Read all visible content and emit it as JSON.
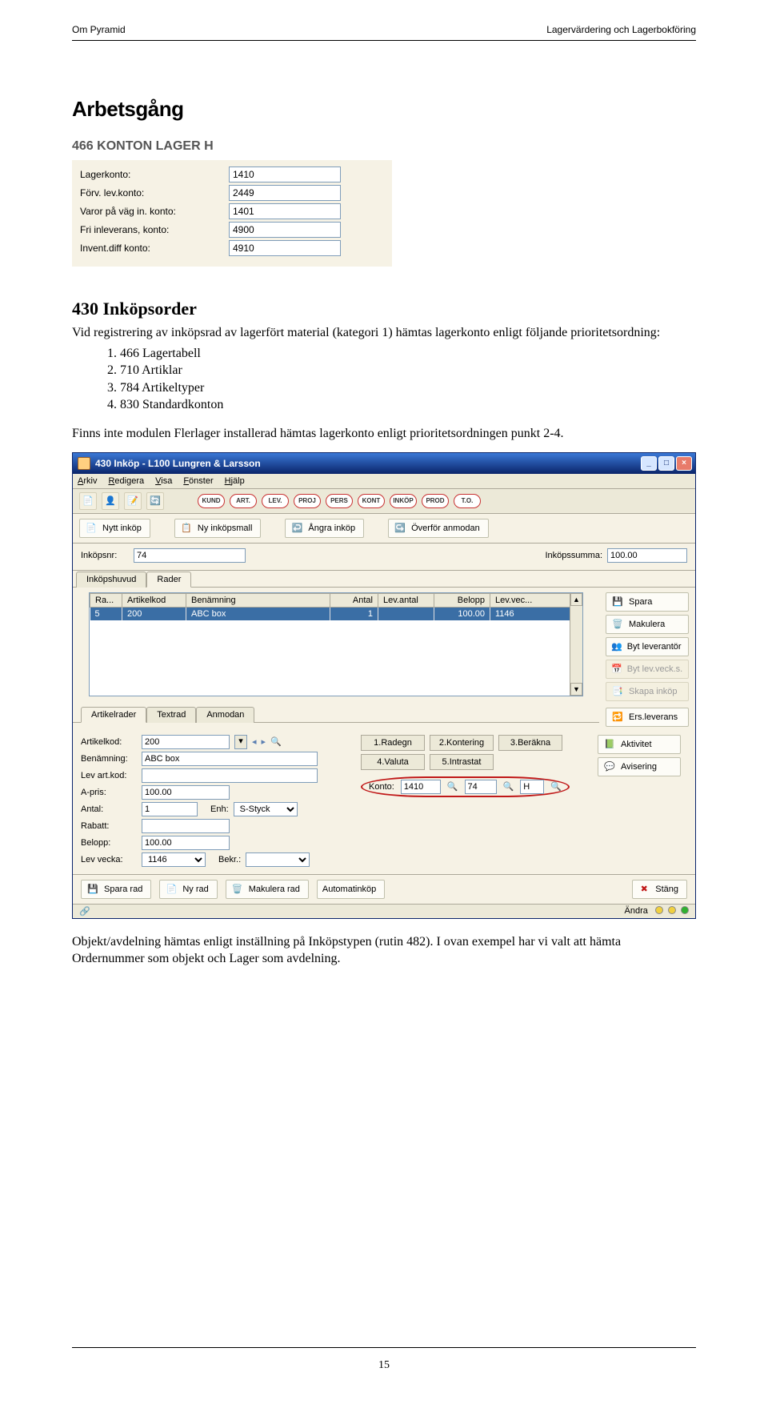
{
  "header": {
    "left": "Om Pyramid",
    "right": "Lagervärdering och Lagerbokföring"
  },
  "titles": {
    "main": "Arbetsgång",
    "section": "466 KONTON LAGER H",
    "sub": "430 Inköpsorder"
  },
  "konton_form": {
    "rows": [
      {
        "label": "Lagerkonto:",
        "value": "1410"
      },
      {
        "label": "Förv. lev.konto:",
        "value": "2449"
      },
      {
        "label": "Varor på väg in. konto:",
        "value": "1401"
      },
      {
        "label": "Fri inleverans, konto:",
        "value": "4900"
      },
      {
        "label": "Invent.diff konto:",
        "value": "4910"
      }
    ]
  },
  "paragraph1": "Vid registrering av inköpsrad av lagerfört material (kategori 1) hämtas lagerkonto enligt följande prioritetsordning:",
  "prio_list": [
    "466 Lagertabell",
    "710 Artiklar",
    "784 Artikeltyper",
    "830 Standardkonton"
  ],
  "paragraph2": "Finns inte modulen Flerlager installerad hämtas lagerkonto enligt prioritetsordningen punkt 2-4.",
  "window": {
    "title": "430 Inköp - L100 Lungren & Larsson",
    "menu": [
      "Arkiv",
      "Redigera",
      "Visa",
      "Fönster",
      "Hjälp"
    ],
    "chips": [
      "KUND",
      "ART.",
      "LEV.",
      "PROJ",
      "PERS",
      "KONT",
      "INKÖP",
      "PROD",
      "T.O."
    ],
    "action_buttons": [
      {
        "icon": "doc-new",
        "label": "Nytt inköp"
      },
      {
        "icon": "template",
        "label": "Ny inköpsmall"
      },
      {
        "icon": "undo",
        "label": "Ångra inköp"
      },
      {
        "icon": "transfer",
        "label": "Överför anmodan"
      }
    ],
    "header_row": {
      "inkopsnr_label": "Inköpsnr:",
      "inkopsnr_value": "74",
      "inkopssumma_label": "Inköpssumma:",
      "inkopssumma_value": "100.00"
    },
    "main_tabs": [
      "Inköpshuvud",
      "Rader"
    ],
    "active_main_tab": 1,
    "grid": {
      "columns": [
        "Ra...",
        "Artikelkod",
        "Benämning",
        "Antal",
        "Lev.antal",
        "Belopp",
        "Lev.vec..."
      ],
      "rows": [
        {
          "ra": "5",
          "artikelkod": "200",
          "benamning": "ABC box",
          "antal": "1",
          "levantal": "",
          "belopp": "100.00",
          "levvec": "1146"
        }
      ]
    },
    "side_buttons_top": [
      {
        "icon": "save",
        "label": "Spara",
        "enabled": true
      },
      {
        "icon": "delete",
        "label": "Makulera",
        "enabled": true
      },
      {
        "icon": "swap",
        "label": "Byt leverantör",
        "enabled": true
      },
      {
        "icon": "week",
        "label": "Byt lev.veck.s.",
        "enabled": false
      },
      {
        "icon": "copy",
        "label": "Skapa inköp",
        "enabled": false
      }
    ],
    "detail_tabs": [
      "Artikelrader",
      "Textrad",
      "Anmodan"
    ],
    "active_detail_tab": 0,
    "side_buttons_mid": [
      {
        "icon": "replace",
        "label": "Ers.leverans",
        "enabled": true
      }
    ],
    "detail_buttons": [
      "1.Radegn",
      "2.Kontering",
      "3.Beräkna",
      "4.Valuta",
      "5.Intrastat"
    ],
    "side_buttons_bottom": [
      {
        "icon": "activity",
        "label": "Aktivitet",
        "enabled": true
      },
      {
        "icon": "bell",
        "label": "Avisering",
        "enabled": true
      }
    ],
    "konto_row": {
      "label": "Konto:",
      "v1": "1410",
      "v2": "74",
      "v3": "H"
    },
    "detail_fields": {
      "artikelkod_label": "Artikelkod:",
      "artikelkod_value": "200",
      "benamning_label": "Benämning:",
      "benamning_value": "ABC box",
      "levartkod_label": "Lev art.kod:",
      "levartkod_value": "",
      "apris_label": "A-pris:",
      "apris_value": "100.00",
      "antal_label": "Antal:",
      "antal_value": "1",
      "enh_label": "Enh:",
      "enh_value": "S-Styck",
      "rabatt_label": "Rabatt:",
      "rabatt_value": "",
      "belopp_label": "Belopp:",
      "belopp_value": "100.00",
      "levvecka_label": "Lev vecka:",
      "levvecka_value": "1146",
      "bekr_label": "Bekr.:",
      "bekr_value": ""
    },
    "footer_buttons": [
      {
        "icon": "save",
        "label": "Spara rad"
      },
      {
        "icon": "new",
        "label": "Ny rad"
      },
      {
        "icon": "delete",
        "label": "Makulera rad"
      },
      {
        "icon": "auto",
        "label": "Automatinköp"
      }
    ],
    "close_button": {
      "icon": "close",
      "label": "Stäng"
    },
    "status_label": "Ändra",
    "leds": [
      "#f0d040",
      "#f0d040",
      "#30b030"
    ]
  },
  "paragraph3": "Objekt/avdelning hämtas enligt inställning på Inköpstypen (rutin 482). I ovan exempel har vi valt att hämta Ordernummer som objekt och Lager som avdelning.",
  "page_number": "15"
}
